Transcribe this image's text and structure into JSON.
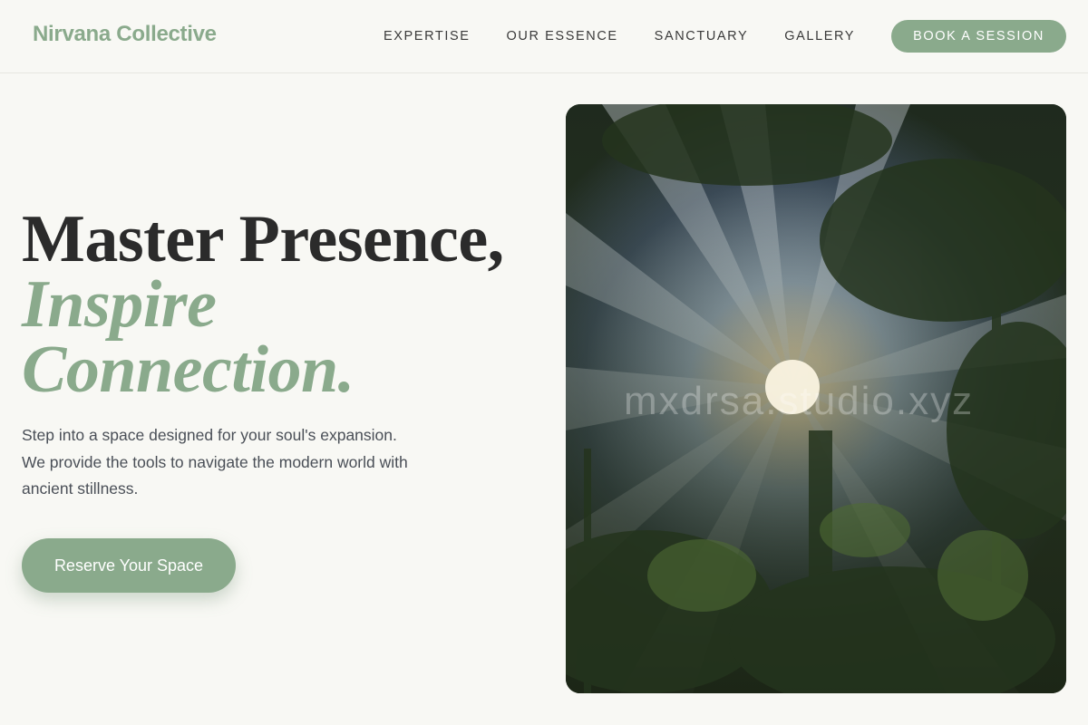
{
  "brand": {
    "logo_text": "Nirvana Collective"
  },
  "nav": {
    "links": [
      "EXPERTISE",
      "OUR ESSENCE",
      "SANCTUARY",
      "GALLERY"
    ],
    "cta_label": "BOOK A SESSION"
  },
  "hero": {
    "title_line1": "Master Presence,",
    "title_line2": "Inspire",
    "title_line3": "Connection.",
    "subtitle": "Step into a space designed for your soul's expansion. We provide the tools to navigate the modern world with ancient stillness.",
    "cta_label": "Reserve Your Space",
    "image_watermark": "mxdrsa.studio.xyz"
  },
  "colors": {
    "accent": "#8aaa8c",
    "background": "#f8f8f4",
    "text": "#2b2b2b"
  }
}
